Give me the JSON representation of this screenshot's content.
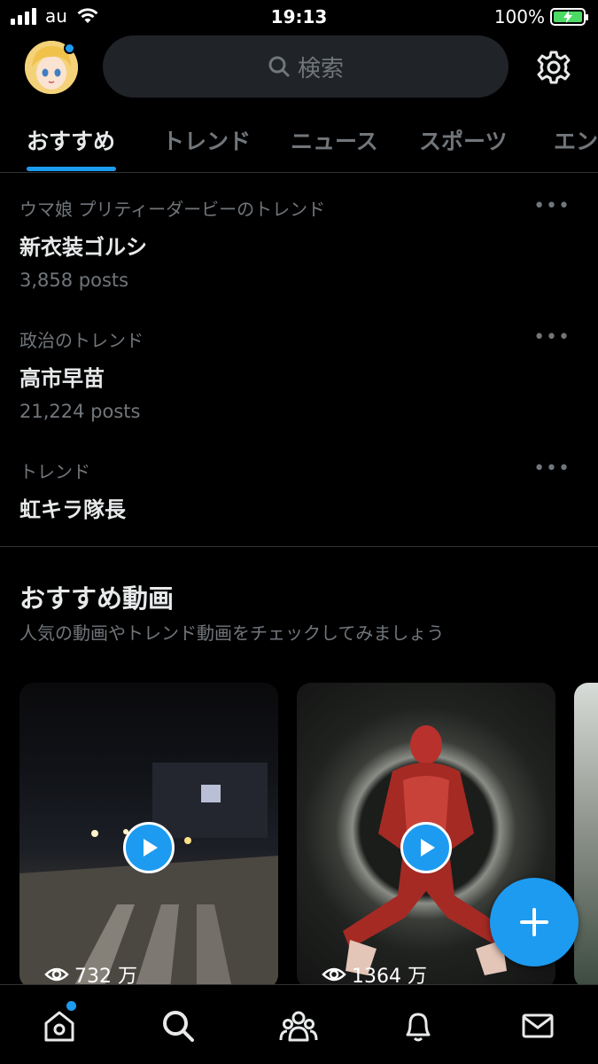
{
  "status_bar": {
    "carrier": "au",
    "time": "19:13",
    "battery": "100%"
  },
  "header": {
    "search_placeholder": "検索"
  },
  "tabs": [
    {
      "label": "おすすめ",
      "active": true
    },
    {
      "label": "トレンド",
      "active": false
    },
    {
      "label": "ニュース",
      "active": false
    },
    {
      "label": "スポーツ",
      "active": false
    },
    {
      "label": "エン",
      "active": false
    }
  ],
  "trends": [
    {
      "context": "ウマ娘 プリティーダービーのトレンド",
      "title": "新衣装ゴルシ",
      "count": "3,858 posts"
    },
    {
      "context": "政治のトレンド",
      "title": "高市早苗",
      "count": "21,224 posts"
    },
    {
      "context": "トレンド",
      "title": "虹キラ隊長",
      "count": ""
    }
  ],
  "videos_section": {
    "title": "おすすめ動画",
    "subtitle": "人気の動画やトレンド動画をチェックしてみましょう",
    "videos": [
      {
        "views": "732 万"
      },
      {
        "views": "1364 万"
      }
    ]
  },
  "more_glyph": "•••",
  "colors": {
    "accent": "#1d9bf0",
    "background": "#000000",
    "secondary_text": "#71767b"
  }
}
